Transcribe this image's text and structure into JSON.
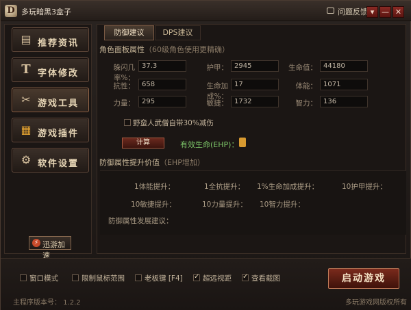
{
  "titlebar": {
    "logo_letter": "D",
    "title": "多玩暗黑3盒子",
    "feedback": "问题反馈",
    "buttons": {
      "dropdown": "▾",
      "minimize": "—",
      "close": "✕"
    }
  },
  "sidebar": {
    "items": [
      {
        "icon": "▤",
        "label": "推荐资讯"
      },
      {
        "icon": "T",
        "label": "字体修改"
      },
      {
        "icon": "✂",
        "label": "游戏工具"
      },
      {
        "icon": "▦",
        "label": "游戏插件"
      },
      {
        "icon": "⚙",
        "label": "软件设置"
      }
    ],
    "speed_button": {
      "icon": "⚡",
      "label": "迅游加速"
    }
  },
  "tabs": [
    {
      "label": "防御建议",
      "active": true
    },
    {
      "label": "DPS建议",
      "active": false
    }
  ],
  "attributes": {
    "title": "角色面板属性",
    "hint": "（60级角色使用更精确）",
    "rows": [
      [
        {
          "label": "躲闪几率%：",
          "value": "37.3"
        },
        {
          "label": "护甲：",
          "value": "2945"
        },
        {
          "label": "生命值：",
          "value": "44180"
        }
      ],
      [
        {
          "label": "抗性：",
          "value": "658"
        },
        {
          "label": "生命加成%：",
          "value": "17"
        },
        {
          "label": "体能：",
          "value": "1071"
        }
      ],
      [
        {
          "label": "力量：",
          "value": "295"
        },
        {
          "label": "敏捷：",
          "value": "1732"
        },
        {
          "label": "智力：",
          "value": "136"
        }
      ]
    ],
    "barbarian_checkbox": "野蛮人武僧自带30%减伤"
  },
  "calc": {
    "button": "计算",
    "result": "有效生命(EHP)："
  },
  "defense": {
    "title": "防御属性提升价值",
    "hint": "（EHP增加）",
    "gains_row1": [
      "1体能提升：",
      "1全抗提升：",
      "1%生命加成提升：",
      "10护甲提升："
    ],
    "gains_row2": [
      "10敏捷提升：",
      "10力量提升：",
      "10智力提升："
    ],
    "advice_label": "防御属性发展建议："
  },
  "bottom": {
    "options": [
      {
        "label": "窗口模式",
        "checked": false
      },
      {
        "label": "限制鼠标范围",
        "checked": false
      },
      {
        "label": "老板键 [F4]",
        "checked": false
      },
      {
        "label": "超远视距",
        "checked": true
      },
      {
        "label": "查看截图",
        "checked": true
      }
    ],
    "start_button": "启动游戏",
    "version": "主程序版本号： 1.2.2",
    "copyright": "多玩游戏网版权所有"
  }
}
